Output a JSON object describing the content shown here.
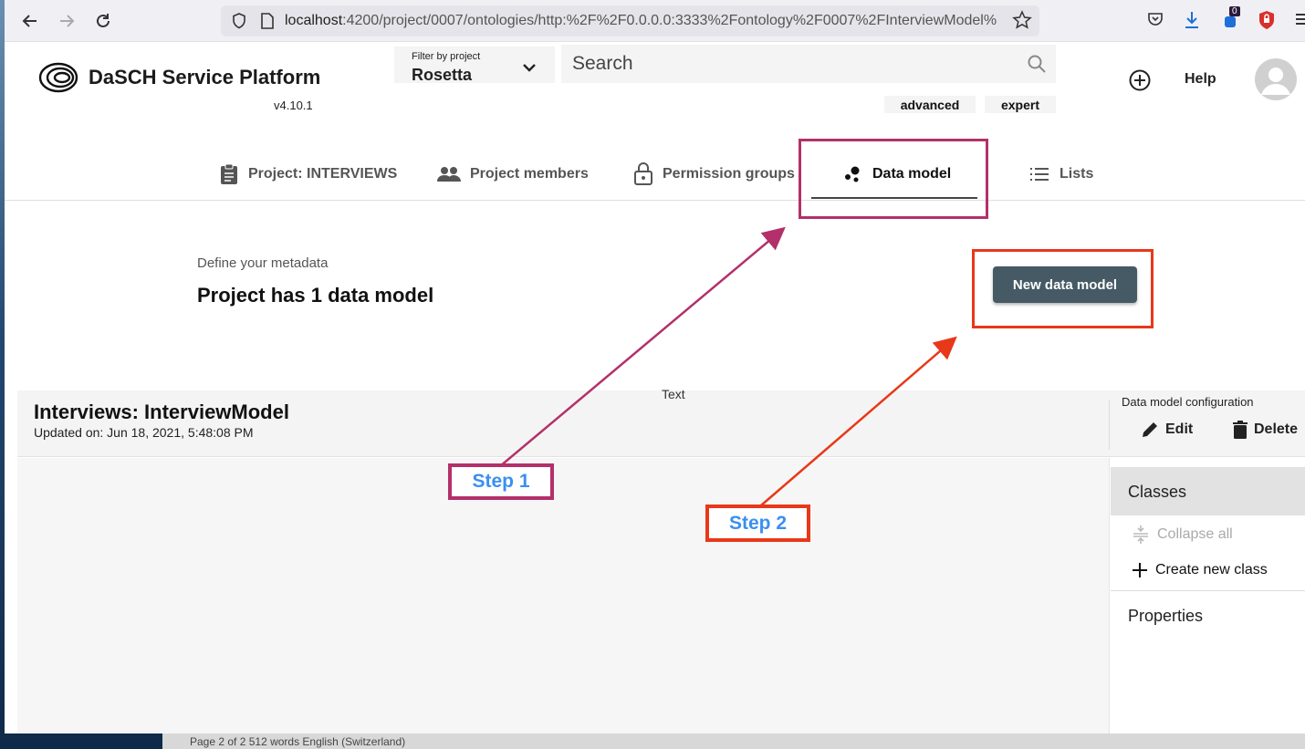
{
  "browser": {
    "url_host": "localhost",
    "url_rest": ":4200/project/0007/ontologies/http:%2F%2F0.0.0.0:3333%2Fontology%2F0007%2FInterviewModel%",
    "extension_badge": "0"
  },
  "app": {
    "title": "DaSCH Service Platform",
    "version": "v4.10.1",
    "filter_label": "Filter by project",
    "filter_value": "Rosetta",
    "search_placeholder": "Search",
    "advanced_label": "advanced",
    "expert_label": "expert",
    "help_label": "Help"
  },
  "tabs": [
    {
      "label": "Project: INTERVIEWS",
      "icon": "clipboard-icon"
    },
    {
      "label": "Project members",
      "icon": "people-icon"
    },
    {
      "label": "Permission groups",
      "icon": "lock-icon"
    },
    {
      "label": "Data model",
      "icon": "bubble-chart-icon",
      "active": true
    },
    {
      "label": "Lists",
      "icon": "list-icon"
    }
  ],
  "overview": {
    "subtitle": "Define your metadata",
    "title": "Project has 1 data model",
    "new_button": "New data model"
  },
  "ontology": {
    "title": "Interviews: InterviewModel",
    "updated": "Updated on: Jun 18, 2021, 5:48:08 PM",
    "text_label": "Text",
    "config_label": "Data model configuration",
    "edit_label": "Edit",
    "delete_label": "Delete"
  },
  "side_panel": {
    "classes_label": "Classes",
    "collapse_label": "Collapse all",
    "create_class_label": "Create new class",
    "properties_label": "Properties"
  },
  "annotations": {
    "step1": "Step 1",
    "step2": "Step 2",
    "step1_color": "#b3306a",
    "step2_color": "#e8381a"
  },
  "status_bar": {
    "text": "Page 2 of 2    512 words    English (Switzerland)"
  }
}
